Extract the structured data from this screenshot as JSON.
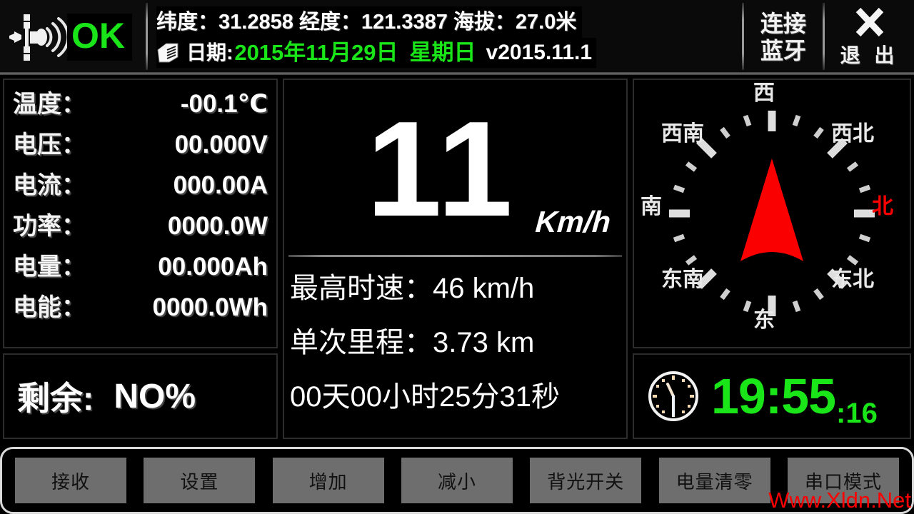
{
  "header": {
    "gps_icon": "satellite-signal-icon",
    "gps_status": "OK",
    "latitude_label": "纬度：",
    "latitude_value": "31.2858",
    "longitude_label": "经度：",
    "longitude_value": "121.3387",
    "altitude_label": "海拔：",
    "altitude_value": "27.0米",
    "gps_line": "纬度：31.2858 经度：121.3387 海拔：27.0米",
    "date_icon": "calendar-scroll-icon",
    "date_label": "日期:",
    "date_value": "2015年11月29日",
    "weekday_value": "星期日",
    "version": "v2015.11.1",
    "bluetooth_line1": "连接",
    "bluetooth_line2": "蓝牙",
    "exit_icon": "close-x-icon",
    "exit_label": "退 出"
  },
  "measurements": [
    {
      "label": "温度：",
      "value": "-00.1℃"
    },
    {
      "label": "电压：",
      "value": "00.000V"
    },
    {
      "label": "电流：",
      "value": "000.00A"
    },
    {
      "label": "功率：",
      "value": "0000.0W"
    },
    {
      "label": "电量：",
      "value": "00.000Ah"
    },
    {
      "label": "电能：",
      "value": "0000.0Wh"
    }
  ],
  "remaining": {
    "label": "剩余:",
    "value": "NO%"
  },
  "speed": {
    "value": "11",
    "unit": "Km/h"
  },
  "stats": [
    {
      "label": "最高时速：",
      "value": "46 km/h"
    },
    {
      "label": "单次里程：",
      "value": "3.73 km"
    },
    {
      "label": "",
      "value": "00天00小时25分31秒"
    }
  ],
  "compass": {
    "needle_color": "#fb0000",
    "heading_deg": 90,
    "labels": [
      {
        "name": "north",
        "text": "北",
        "color": "#fb0000"
      },
      {
        "name": "northeast",
        "text": "东北",
        "color": "#e8e8e8"
      },
      {
        "name": "east",
        "text": "东",
        "color": "#e8e8e8"
      },
      {
        "name": "southeast",
        "text": "东南",
        "color": "#e8e8e8"
      },
      {
        "name": "south",
        "text": "南",
        "color": "#e8e8e8"
      },
      {
        "name": "southwest",
        "text": "西南",
        "color": "#e8e8e8"
      },
      {
        "name": "west",
        "text": "西",
        "color": "#e8e8e8"
      },
      {
        "name": "northwest",
        "text": "西北",
        "color": "#e8e8e8"
      }
    ]
  },
  "clock": {
    "icon": "analog-clock-icon",
    "time": "19:55",
    "seconds": ":16"
  },
  "toolbar": [
    {
      "name": "receive",
      "label": "接收"
    },
    {
      "name": "settings",
      "label": "设置"
    },
    {
      "name": "increase",
      "label": "增加"
    },
    {
      "name": "decrease",
      "label": "减小"
    },
    {
      "name": "backlight-switch",
      "label": "背光开关"
    },
    {
      "name": "clear-capacity",
      "label": "电量清零"
    },
    {
      "name": "serial-port-mode",
      "label": "串口模式"
    }
  ],
  "watermark": "Www.Xldn.Net",
  "colors": {
    "green": "#19e519",
    "red": "#fb0000",
    "button_gray": "#6e6e6e",
    "panel_border": "#2c2c2c"
  }
}
